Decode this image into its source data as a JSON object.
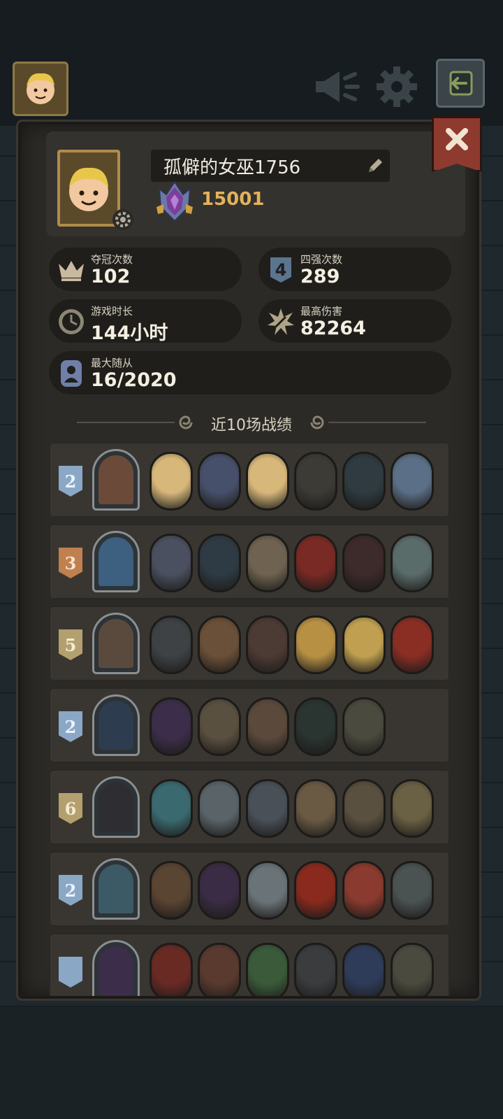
{
  "header": {
    "avatar_icon": "player-avatar-icon",
    "mute_icon": "megaphone-icon",
    "settings_icon": "gear-icon",
    "exit_icon": "exit-arrow-icon"
  },
  "panel": {
    "close_icon": "close-x-icon"
  },
  "profile": {
    "name": "孤僻的女巫1756",
    "rank_score": "15001",
    "edit_icon": "pencil-icon",
    "rank_icon": "rank-emblem-icon"
  },
  "stats": {
    "championships": {
      "label": "夺冠次数",
      "value": "102",
      "icon": "crown-icon"
    },
    "top_four": {
      "label": "四强次数",
      "value": "289",
      "icon": "top4-shield-icon"
    },
    "play_time": {
      "label": "游戏时长",
      "value": "144小时",
      "icon": "clock-icon"
    },
    "max_damage": {
      "label": "最高伤害",
      "value": "82264",
      "icon": "damage-burst-icon"
    },
    "max_minions": {
      "label": "最大随从",
      "value": "16/2020",
      "icon": "minion-card-icon"
    }
  },
  "recent": {
    "title": "近10场战绩"
  },
  "matches": [
    {
      "rank": "2",
      "badge": "blue",
      "hero_color": "#6b4a3a",
      "minions": [
        "#d7b77a",
        "#47506a",
        "#d7b77a",
        "#3c3b36",
        "#2f3b40",
        "#5b6f86"
      ]
    },
    {
      "rank": "3",
      "badge": "bronze",
      "hero_color": "#3d5f80",
      "minions": [
        "#4b5060",
        "#2e3b44",
        "#6f6250",
        "#7a2a24",
        "#3d2a2a",
        "#5a6c6a"
      ]
    },
    {
      "rank": "5",
      "badge": "tan",
      "hero_color": "#5a4a3e",
      "minions": [
        "#3e4244",
        "#6a5038",
        "#4c3a34",
        "#b89044",
        "#c0a050",
        "#8a2e24"
      ]
    },
    {
      "rank": "2",
      "badge": "blue",
      "hero_color": "#2d3c4e",
      "minions": [
        "#3c2e4a",
        "#5a5040",
        "#5b4a3c",
        "#2a3430",
        "#4a4a3e"
      ]
    },
    {
      "rank": "6",
      "badge": "tan",
      "hero_color": "#2e2e32",
      "minions": [
        "#3a6a70",
        "#5a6468",
        "#4a5058",
        "#6a5a44",
        "#5a5040",
        "#6a6044"
      ]
    },
    {
      "rank": "2",
      "badge": "blue",
      "hero_color": "#3c5a66",
      "minions": [
        "#5a4432",
        "#3a2c44",
        "#6a7478",
        "#8a2a1e",
        "#8a3a2e",
        "#4a5252"
      ]
    },
    {
      "rank": "",
      "badge": "blue",
      "hero_color": "#3c2e4a",
      "minions": [
        "#6a2a24",
        "#5a3a2e",
        "#3a5a3a",
        "#3a3c3e",
        "#2e3c5a",
        "#4a4a3e"
      ]
    }
  ]
}
